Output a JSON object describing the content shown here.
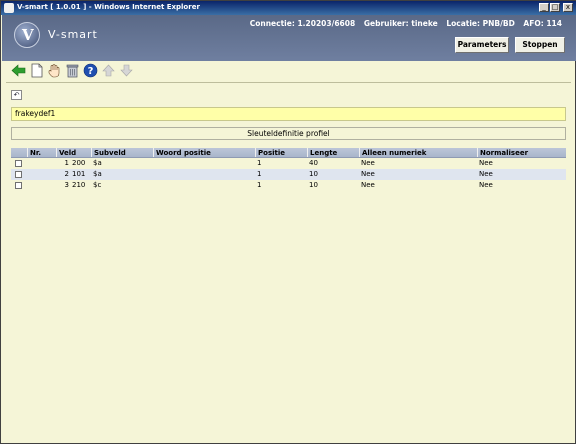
{
  "window": {
    "title": "V-smart [ 1.0.01 ] - Windows Internet Explorer",
    "controls": [
      "_",
      "□",
      "x"
    ]
  },
  "header": {
    "logo_letter": "V",
    "logo_text": "V-smart",
    "connection": "Connectie: 1.20203/6608",
    "user": "Gebruiker: tineke",
    "location": "Locatie: PNB/BD",
    "afo": "AFO: 114",
    "parameters_label": "Parameters",
    "stop_label": "Stoppen"
  },
  "toolbar": {
    "icons": [
      "back-arrow-icon",
      "new-document-icon",
      "select-hand-icon",
      "delete-trash-icon",
      "help-icon",
      "move-up-icon",
      "move-down-icon"
    ]
  },
  "undo_glyph": "↶",
  "profile_name": "frakeydef1",
  "section_title": "Sleuteldefinitie profiel",
  "table": {
    "headers": [
      "",
      "Nr.",
      "Veld",
      "Subveld",
      "Woord positie",
      "Positie",
      "Lengte",
      "Alleen numeriek",
      "Normaliseer"
    ],
    "rows": [
      {
        "nr": "1",
        "veld": "200",
        "subveld": "$a",
        "woord_positie": "",
        "positie": "1",
        "lengte": "40",
        "alleen_numeriek": "Nee",
        "normaliseer": "Nee"
      },
      {
        "nr": "2",
        "veld": "101",
        "subveld": "$a",
        "woord_positie": "",
        "positie": "1",
        "lengte": "10",
        "alleen_numeriek": "Nee",
        "normaliseer": "Nee"
      },
      {
        "nr": "3",
        "veld": "210",
        "subveld": "$c",
        "woord_positie": "",
        "positie": "1",
        "lengte": "10",
        "alleen_numeriek": "Nee",
        "normaliseer": "Nee"
      }
    ]
  },
  "colors": {
    "header_bg": "#5a6987",
    "page_bg": "#f5f5d7",
    "field_bg": "#ffffa8",
    "table_header_bg": "#bcc6d8",
    "alt_row_bg": "#dfe5ef",
    "icon_green": "#2e9e2e",
    "icon_blue": "#1f4fb0"
  }
}
